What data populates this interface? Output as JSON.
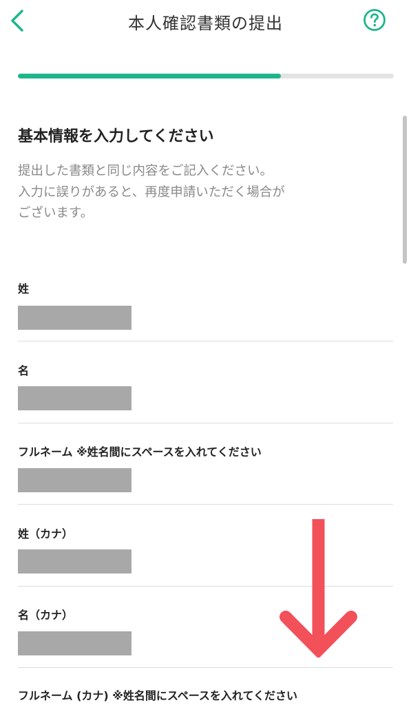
{
  "header": {
    "title": "本人確認書類の提出",
    "back_icon": "chevron-left-icon",
    "help_icon": "question-circle-icon",
    "accent_color": "#1db68b"
  },
  "progress": {
    "fraction": 0.7
  },
  "main": {
    "heading": "基本情報を入力してください",
    "description_lines": [
      "提出した書類と同じ内容をご記入ください。",
      "入力に誤りがあると、再度申請いただく場合が",
      "ございます。"
    ],
    "fields": [
      {
        "label": "姓",
        "note": ""
      },
      {
        "label": "名",
        "note": ""
      },
      {
        "label": "フルネーム ",
        "note": "※姓名間にスペースを入れてください"
      },
      {
        "label": "姓（カナ）",
        "note": ""
      },
      {
        "label": "名（カナ）",
        "note": ""
      },
      {
        "label": "フルネーム (カナ) ",
        "note": "※姓名間にスペースを入れてください"
      }
    ]
  },
  "annotation": {
    "arrow_icon": "arrow-down-icon",
    "arrow_color": "#f2515a"
  }
}
